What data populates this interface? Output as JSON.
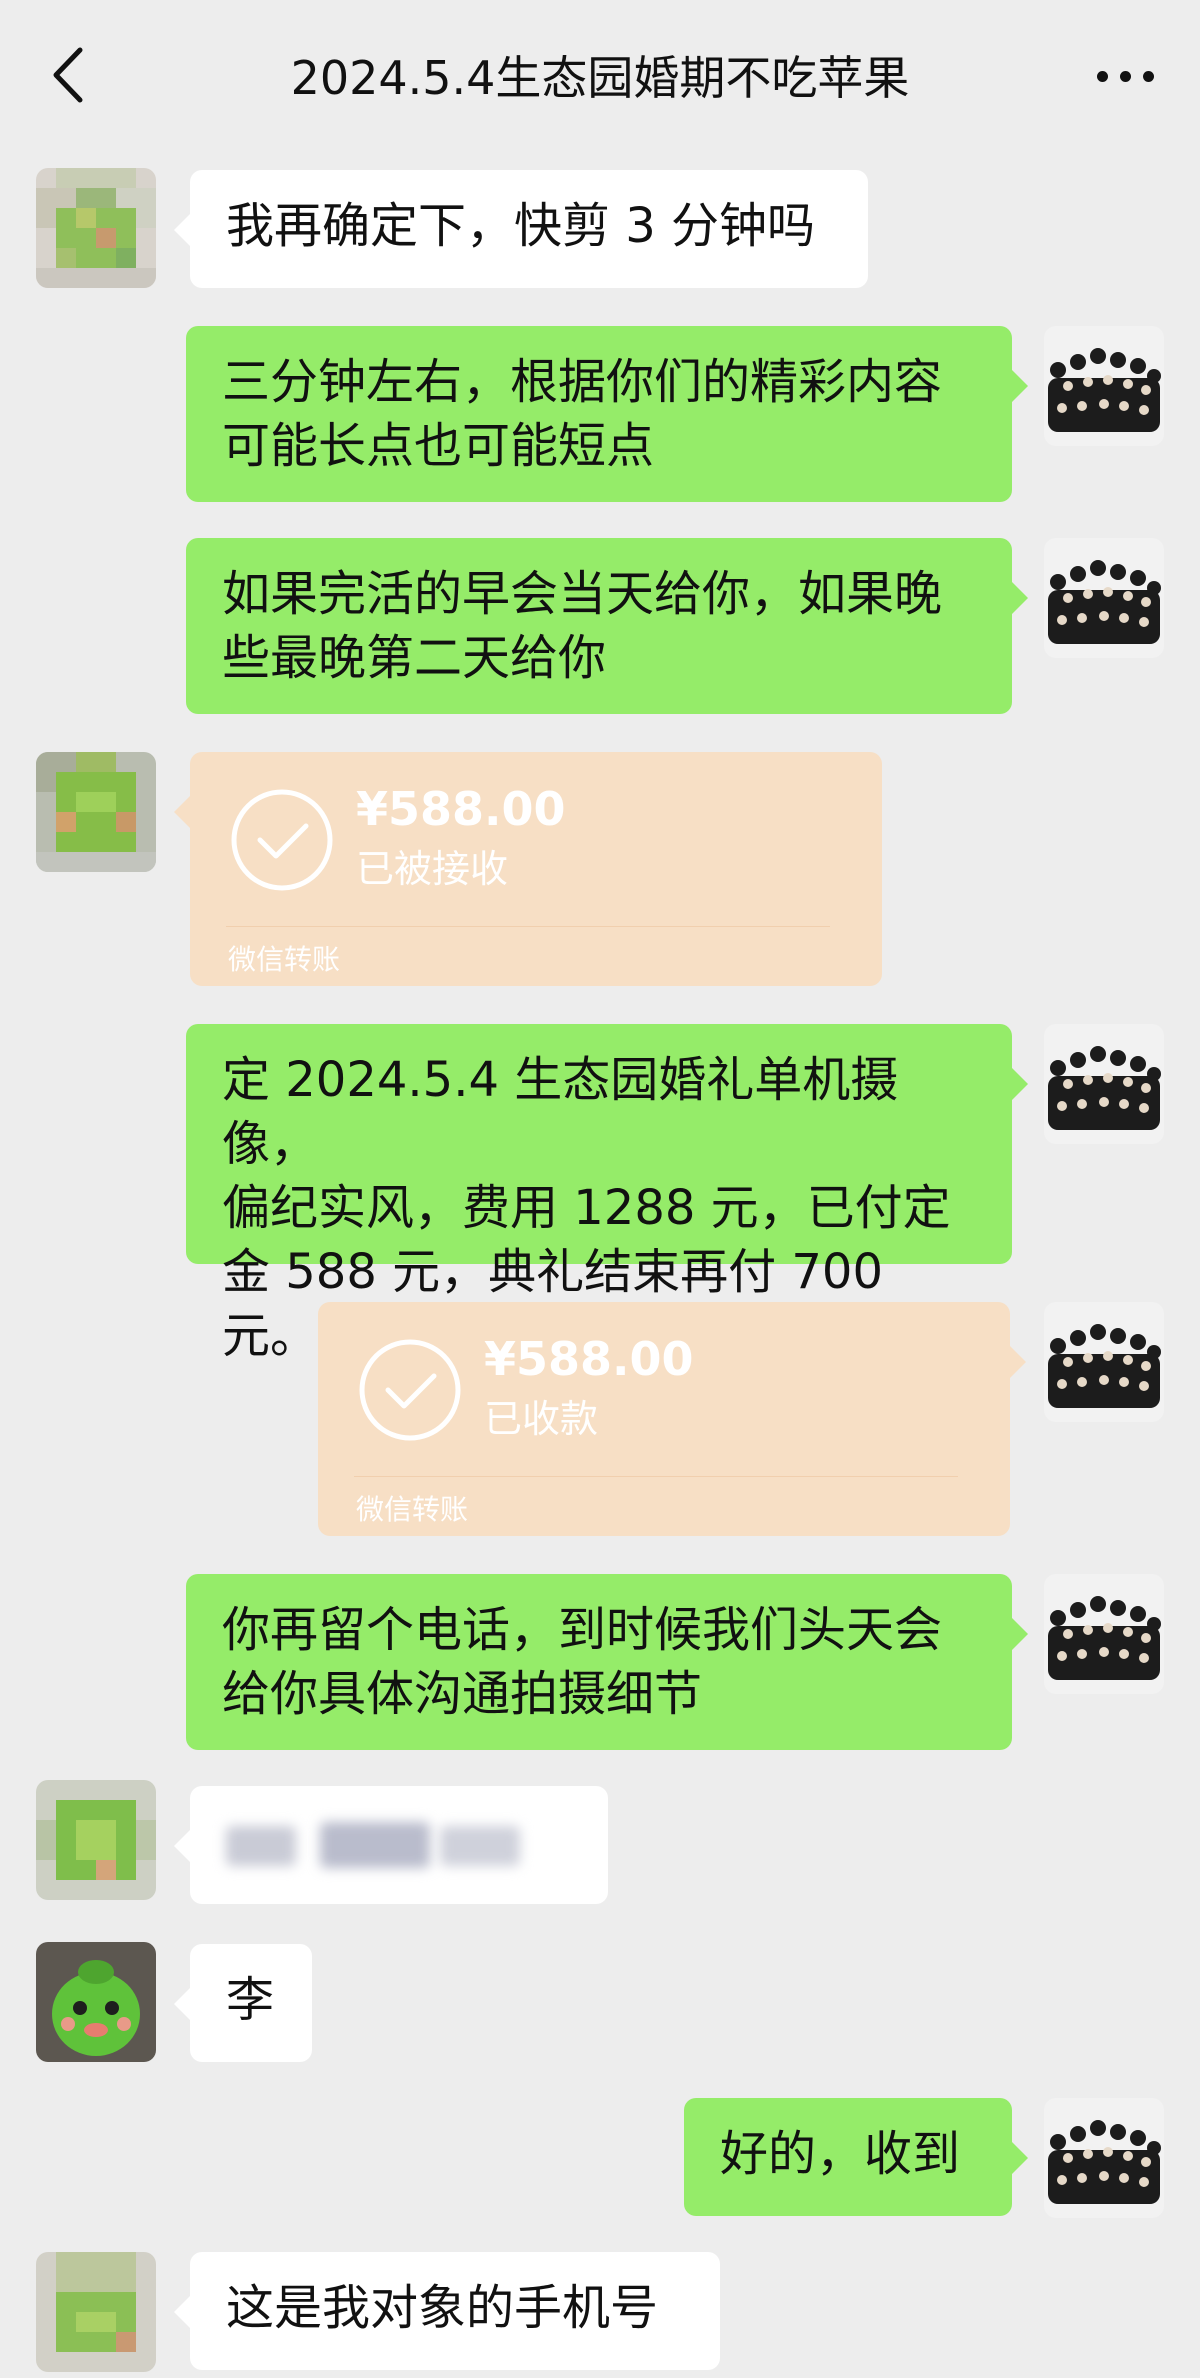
{
  "header": {
    "title": "2024.5.4生态园婚期不吃苹果"
  },
  "messages": [
    {
      "side": "left",
      "type": "text",
      "text": "我再确定下，快剪 3 分钟吗"
    },
    {
      "side": "right",
      "type": "text",
      "lines": [
        "三分钟左右，根据你们的精彩内容",
        "可能长点也可能短点"
      ]
    },
    {
      "side": "right",
      "type": "text",
      "lines": [
        "如果完活的早会当天给你，如果晚",
        "些最晚第二天给你"
      ]
    },
    {
      "side": "left",
      "type": "transfer",
      "amount": "¥588.00",
      "status": "已被接收",
      "brand": "微信转账"
    },
    {
      "side": "right",
      "type": "text",
      "lines": [
        "定 2024.5.4 生态园婚礼单机摄像，",
        "偏纪实风，费用 1288 元，已付定",
        "金 588 元，典礼结束再付 700 元。"
      ]
    },
    {
      "side": "right",
      "type": "transfer",
      "amount": "¥588.00",
      "status": "已收款",
      "brand": "微信转账"
    },
    {
      "side": "right",
      "type": "text",
      "lines": [
        "你再留个电话，到时候我们头天会",
        "给你具体沟通拍摄细节"
      ]
    },
    {
      "side": "left",
      "type": "redacted"
    },
    {
      "side": "left",
      "type": "text",
      "text": "李"
    },
    {
      "side": "right",
      "type": "text",
      "text": "好的，收到"
    },
    {
      "side": "left",
      "type": "text",
      "text": "这是我对象的手机号"
    }
  ],
  "colors": {
    "background": "#ededed",
    "bubble_green": "#95ec69",
    "bubble_white": "#ffffff",
    "transfer_bg": "#f7dfc5"
  },
  "icons": {
    "back": "chevron-left-icon",
    "more": "more-dots-icon",
    "transfer": "check-circle-icon"
  }
}
